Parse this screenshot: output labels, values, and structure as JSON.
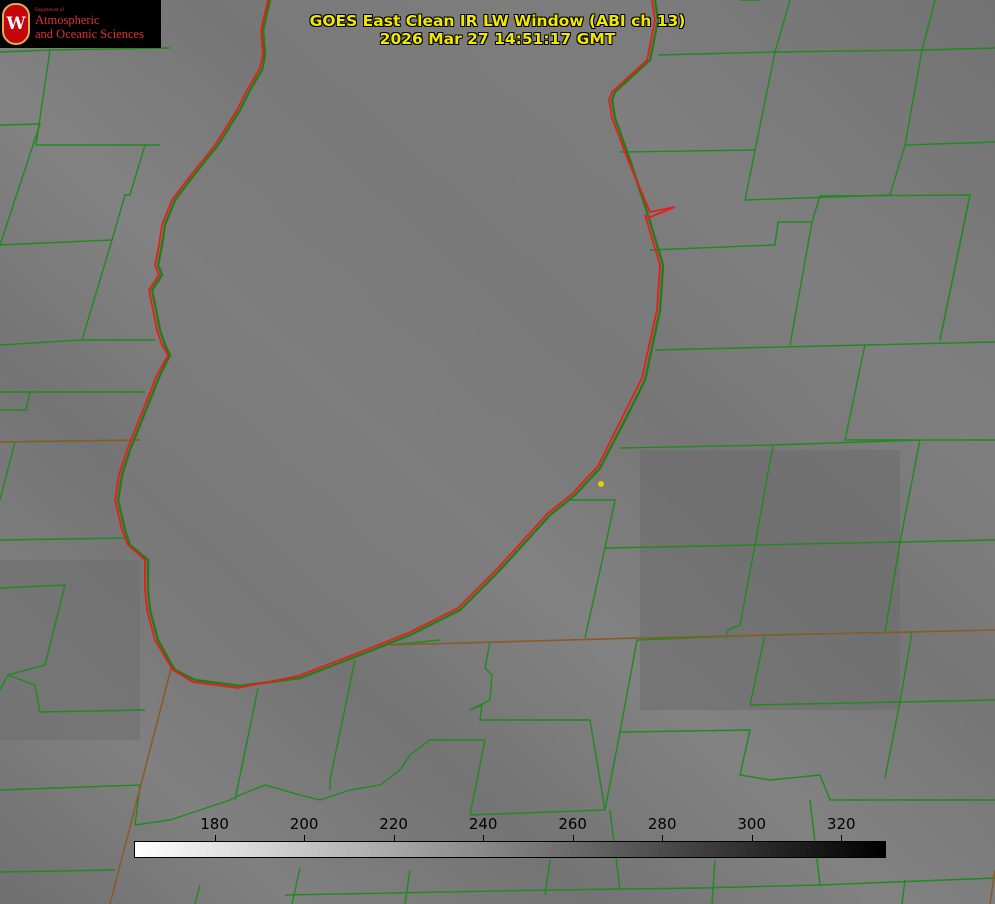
{
  "title": {
    "line1": "GOES East Clean IR LW Window (ABI ch 13)",
    "line2": "2026 Mar 27 14:51:17 GMT"
  },
  "logo": {
    "small": "Department of",
    "line1": "Atmospheric",
    "line2": "and Oceanic Sciences",
    "seal_letter": "W"
  },
  "colorbar": {
    "range": [
      162,
      330
    ],
    "ticks": [
      "180",
      "200",
      "220",
      "240",
      "260",
      "280",
      "300",
      "320"
    ],
    "gradient": [
      "#ffffff",
      "#000000"
    ]
  },
  "colors": {
    "background_gray": "#7a7a7a",
    "county_lines": "#1f8a1f",
    "shoreline": "#e81c1c",
    "title_text": "#f0e800",
    "marker": "#e0d000"
  }
}
